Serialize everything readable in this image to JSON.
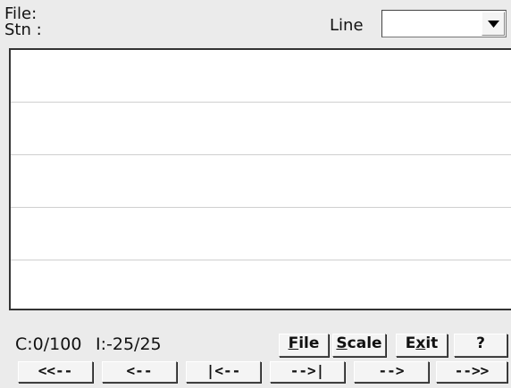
{
  "header": {
    "file_label": "File:",
    "stn_label": "Stn :",
    "line_label": "Line",
    "line_value": ""
  },
  "status": {
    "counter": "C:0/100",
    "index": "I:-25/25"
  },
  "menu": {
    "file": {
      "mnemonic": "F",
      "rest": "ile"
    },
    "scale": {
      "mnemonic": "S",
      "rest": "cale"
    },
    "exit": {
      "pre": "E",
      "mnemonic": "x",
      "rest": "it"
    },
    "help": "?"
  },
  "nav": {
    "first": "<<--",
    "prev": "<--",
    "start": "|<--",
    "end": "-->|",
    "next": "-->",
    "last": "-->>"
  },
  "icons": {
    "dropdown": "chevron-down-icon"
  }
}
